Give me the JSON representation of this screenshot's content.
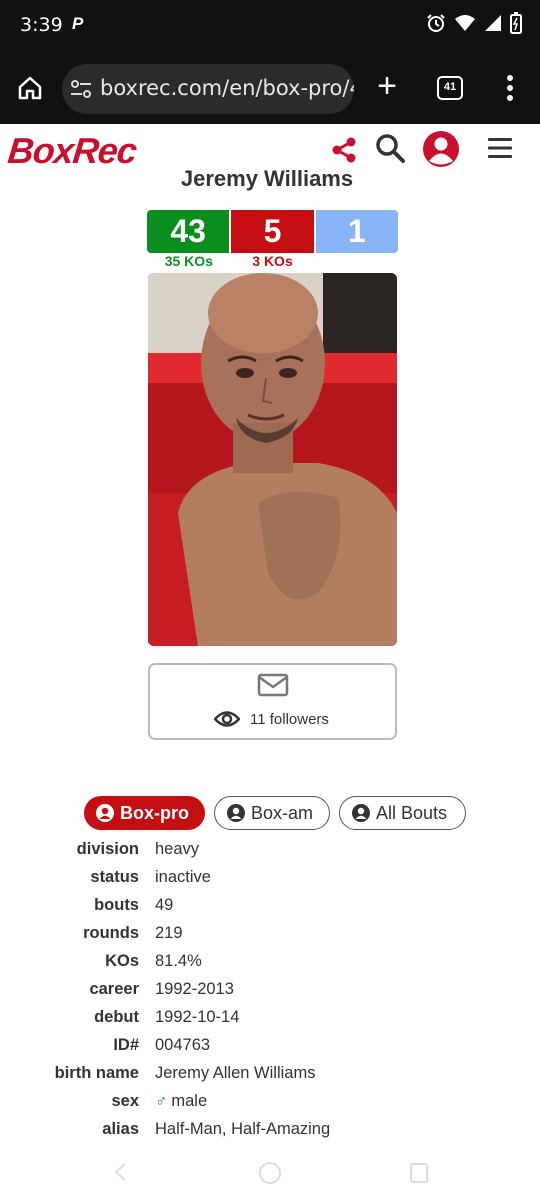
{
  "status_bar": {
    "time": "3:39",
    "app_letter": "P",
    "icons": [
      "alarm-icon",
      "wifi-icon",
      "signal-icon",
      "battery-icon"
    ]
  },
  "browser": {
    "url": "boxrec.com/en/box-pro/4",
    "tab_count": "41",
    "icons": [
      "home-icon",
      "site-settings-icon",
      "new-tab-icon",
      "tabs-icon",
      "more-icon"
    ]
  },
  "site": {
    "logo": "BoxRec",
    "brand_color": "#c8102e",
    "icons": [
      "share-icon",
      "search-icon",
      "user-icon",
      "hamburger-icon"
    ]
  },
  "boxer": {
    "name": "Jeremy Williams",
    "record": {
      "wins": "43",
      "losses": "5",
      "draws": "1"
    },
    "kos_wins": "35 KOs",
    "kos_losses": "3 KOs",
    "followers": "11 followers"
  },
  "colors": {
    "win": "#0a8f1e",
    "loss": "#c40e12",
    "draw": "#8ab4f8"
  },
  "tabs": [
    {
      "label": "Box-pro",
      "active": true
    },
    {
      "label": "Box-am",
      "active": false
    },
    {
      "label": "All Bouts",
      "active": false
    }
  ],
  "details": [
    {
      "label": "division",
      "value": "heavy"
    },
    {
      "label": "status",
      "value": "inactive"
    },
    {
      "label": "bouts",
      "value": "49"
    },
    {
      "label": "rounds",
      "value": "219"
    },
    {
      "label": "KOs",
      "value": "81.4%"
    },
    {
      "label": "career",
      "value": "1992-2013"
    },
    {
      "label": "debut",
      "value": "1992-10-14"
    },
    {
      "label": "ID#",
      "value": "004763"
    },
    {
      "label": "birth name",
      "value": "Jeremy Allen Williams"
    },
    {
      "label": "sex",
      "value": "male",
      "symbol": "♂"
    },
    {
      "label": "alias",
      "value": "Half-Man, Half-Amazing"
    }
  ]
}
